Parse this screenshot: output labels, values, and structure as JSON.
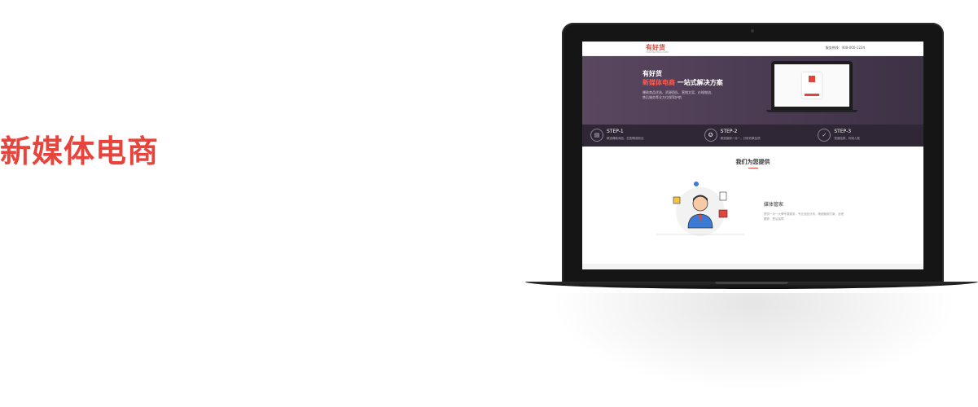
{
  "headline": "新媒体电商",
  "inner_site": {
    "logo": "有好货",
    "logo_sub": "YOUHAOHUO.COM",
    "contact": "服务热线：400-000-1234",
    "hero": {
      "title_line1": "有好货",
      "title_red": "新媒体电商",
      "title_rest": " 一站式解决方案",
      "description": "爆款商品优选、资源团队、营销文案、价格物流、售后服务等全方位保驾护航"
    },
    "steps": [
      {
        "name": "STEP-1",
        "desc": "精选爆款商品，匹配精准粉丝",
        "icon": "doc-icon"
      },
      {
        "name": "STEP-2",
        "desc": "精准营销一对一，分析效果反馈",
        "icon": "award-icon"
      },
      {
        "name": "STEP-3",
        "desc": "快速结算，利润入账",
        "icon": "check-icon"
      }
    ],
    "section_title": "我们为您提供",
    "service": {
      "name": "媒体管家",
      "description": "提供一对一大牌专属服务，专业选品分析，精细营销方案，全程跟踪，售后保障"
    }
  },
  "colors": {
    "accent": "#e8443c",
    "hero_bg": "#4e3f55",
    "steps_bg": "#2f2735"
  }
}
